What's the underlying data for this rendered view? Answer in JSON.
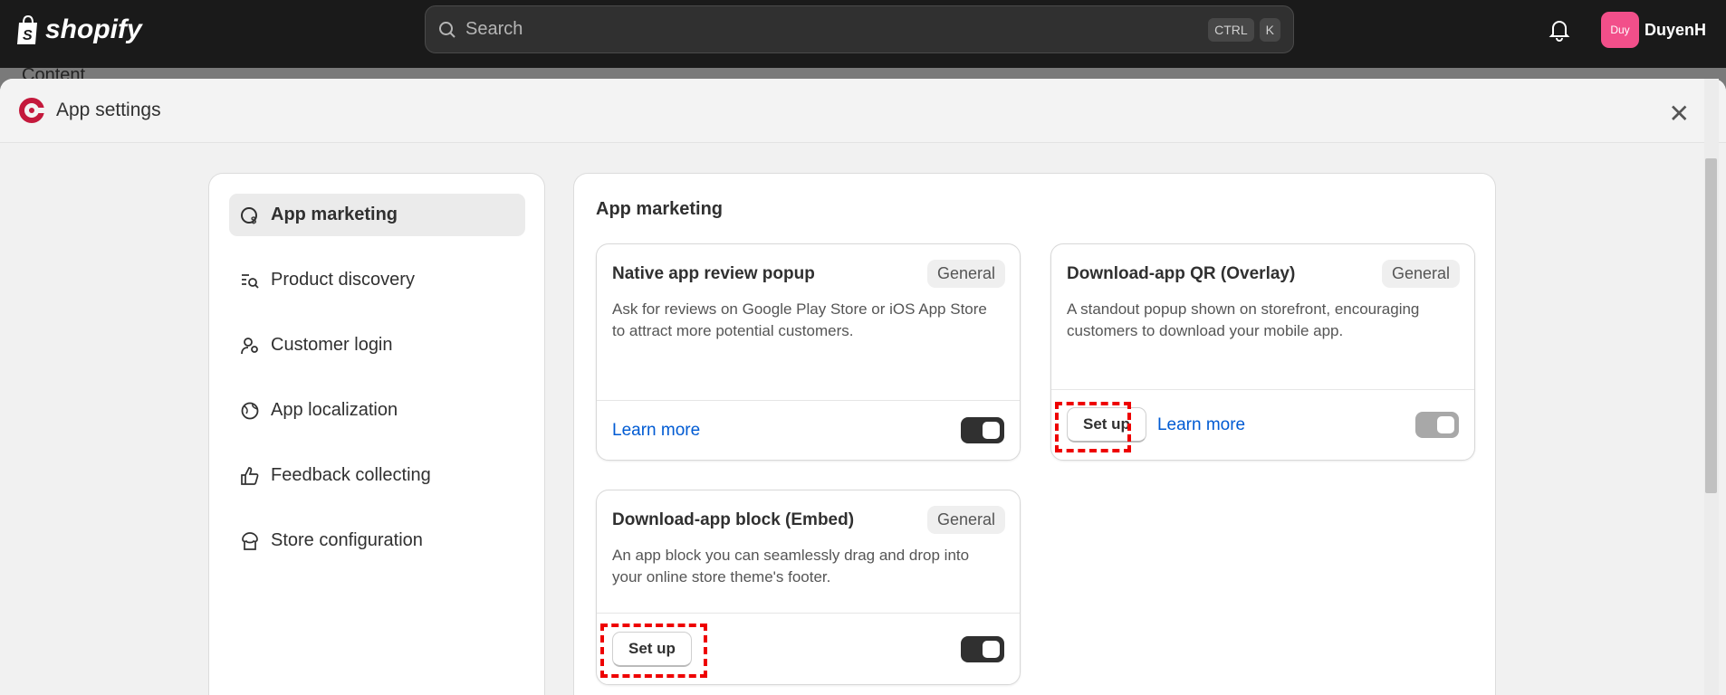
{
  "topbar": {
    "brand": "shopify",
    "search_placeholder": "Search",
    "shortcut": [
      "CTRL",
      "K"
    ],
    "user_initials": "Duy",
    "user_name": "DuyenH",
    "avatar_color": "#f24f8a"
  },
  "background_nav_item": "Content",
  "modal": {
    "title": "App settings",
    "accent": "#c4193c"
  },
  "sidebar": {
    "items": [
      {
        "label": "App marketing",
        "icon": "globe-dollar-icon",
        "selected": true
      },
      {
        "label": "Product discovery",
        "icon": "list-search-icon"
      },
      {
        "label": "Customer login",
        "icon": "user-key-icon"
      },
      {
        "label": "App localization",
        "icon": "globe-icon"
      },
      {
        "label": "Feedback collecting",
        "icon": "thumbs-up-icon"
      },
      {
        "label": "Store configuration",
        "icon": "store-icon"
      }
    ]
  },
  "main": {
    "title": "App marketing",
    "cards": [
      {
        "title": "Native app review popup",
        "badge": "General",
        "description": "Ask for reviews on Google Play Store or iOS App Store to attract more potential customers.",
        "learn_more": "Learn more",
        "toggle_on": true
      },
      {
        "title": "Download-app QR (Overlay)",
        "badge": "General",
        "description": "A standout popup shown on storefront, encouraging customers to download your mobile app.",
        "setup": "Set up",
        "learn_more": "Learn more",
        "toggle_on": false
      },
      {
        "title": "Download-app block (Embed)",
        "badge": "General",
        "description": "An app block you can seamlessly drag and drop into your online store theme's footer.",
        "setup": "Set up",
        "toggle_on": true
      }
    ]
  }
}
